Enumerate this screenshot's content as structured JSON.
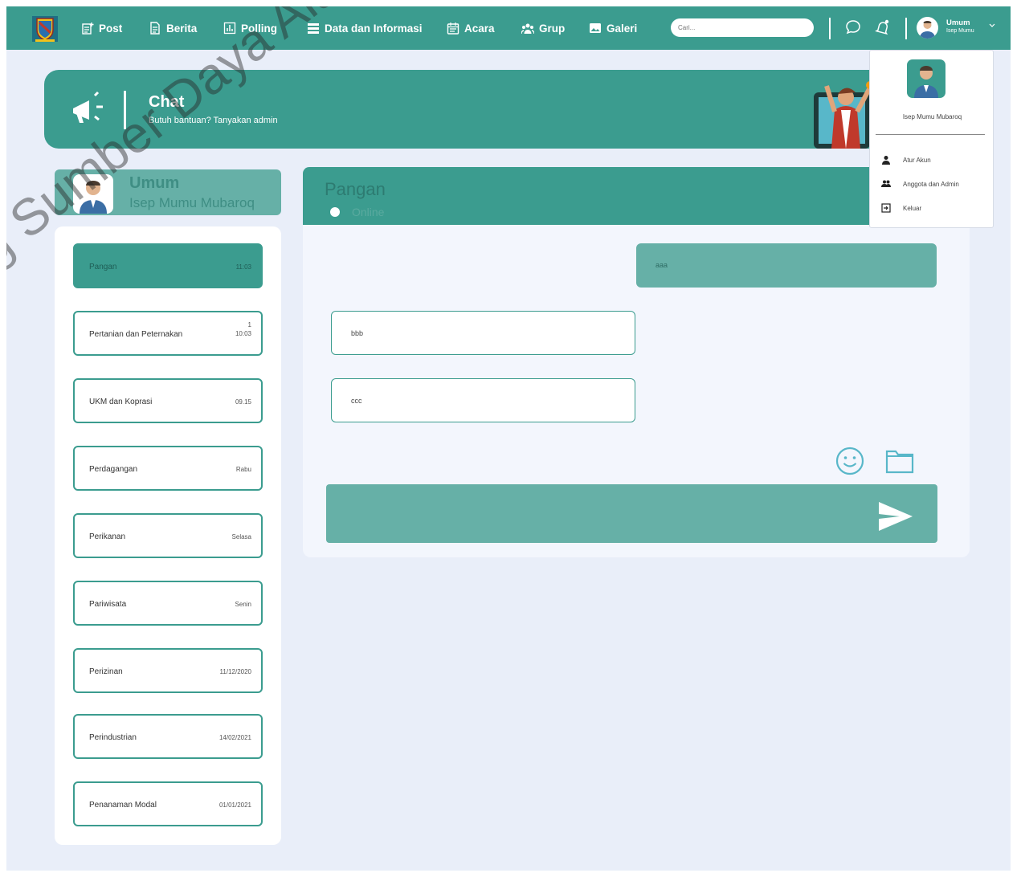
{
  "nav": {
    "items": [
      {
        "label": "Post",
        "icon": "post-icon"
      },
      {
        "label": "Berita",
        "icon": "news-icon"
      },
      {
        "label": "Polling",
        "icon": "poll-icon"
      },
      {
        "label": "Data dan Informasi",
        "icon": "data-icon"
      },
      {
        "label": "Acara",
        "icon": "calendar-icon"
      },
      {
        "label": "Grup",
        "icon": "group-icon"
      },
      {
        "label": "Galeri",
        "icon": "gallery-icon"
      }
    ],
    "search_placeholder": "Cari...",
    "user_name": "Umum",
    "user_sub": "Isep Mumu"
  },
  "banner": {
    "title": "Chat",
    "subtitle": "Butuh bantuan? Tanyakan admin"
  },
  "profile": {
    "title": "Umum",
    "name": "Isep Mumu Mubaroq"
  },
  "chat_list": [
    {
      "name": "Pangan",
      "time": "11:03",
      "badge": "",
      "active": true
    },
    {
      "name": "Pertanian dan Peternakan",
      "time": "10:03",
      "badge": "1",
      "active": false
    },
    {
      "name": "UKM dan Koprasi",
      "time": "09.15",
      "badge": "",
      "active": false
    },
    {
      "name": "Perdagangan",
      "time": "Rabu",
      "badge": "",
      "active": false
    },
    {
      "name": "Perikanan",
      "time": "Selasa",
      "badge": "",
      "active": false
    },
    {
      "name": "Pariwisata",
      "time": "Senin",
      "badge": "",
      "active": false
    },
    {
      "name": "Perizinan",
      "time": "11/12/2020",
      "badge": "",
      "active": false
    },
    {
      "name": "Perindustrian",
      "time": "14/02/2021",
      "badge": "",
      "active": false
    },
    {
      "name": "Penanaman Modal",
      "time": "01/01/2021",
      "badge": "",
      "active": false
    }
  ],
  "chat": {
    "title": "Pangan",
    "status": "Online",
    "messages": [
      {
        "text": "aaa",
        "direction": "out"
      },
      {
        "text": "bbb",
        "direction": "in"
      },
      {
        "text": "ccc",
        "direction": "in"
      }
    ]
  },
  "dropdown": {
    "name": "Isep Mumu Mubaroq",
    "items": [
      {
        "label": "Atur Akun",
        "icon": "user-icon"
      },
      {
        "label": "Anggota dan Admin",
        "icon": "users-icon"
      },
      {
        "label": "Keluar",
        "icon": "logout-icon"
      }
    ]
  },
  "watermark": "ng Sumber Daya Alam & Investasi",
  "colors": {
    "primary": "#3b9c8f",
    "primary_light": "#66b0a7",
    "background": "#e9eef9"
  }
}
